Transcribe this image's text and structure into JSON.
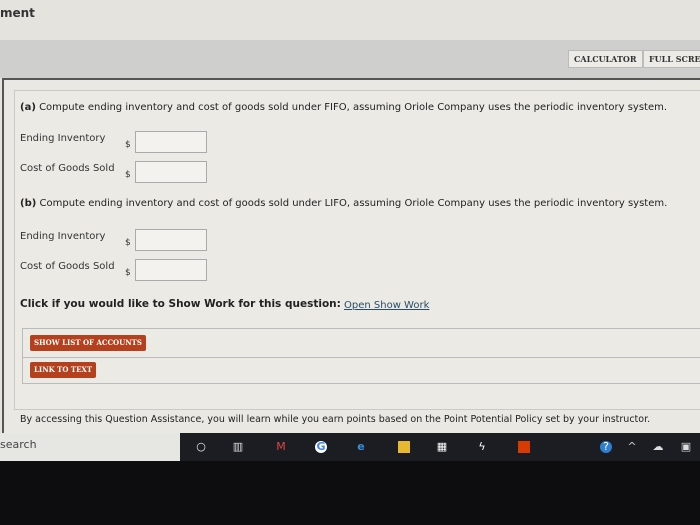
{
  "window_title": "ment",
  "toolbar": {
    "calculator": "CALCULATOR",
    "full_screen": "FULL SCREEN"
  },
  "part_a": {
    "prefix": "(a)",
    "question": "Compute ending inventory and cost of goods sold under FIFO, assuming Oriole Company uses the periodic inventory system.",
    "fields": [
      {
        "label": "Ending Inventory",
        "currency": "$",
        "value": ""
      },
      {
        "label": "Cost of Goods Sold",
        "currency": "$",
        "value": ""
      }
    ]
  },
  "part_b": {
    "prefix": "(b)",
    "question": "Compute ending inventory and cost of goods sold under LIFO, assuming Oriole Company uses the periodic inventory system.",
    "fields": [
      {
        "label": "Ending Inventory",
        "currency": "$",
        "value": ""
      },
      {
        "label": "Cost of Goods Sold",
        "currency": "$",
        "value": ""
      }
    ]
  },
  "show_work": {
    "prompt": "Click if you would like to Show Work for this question:",
    "link": "Open Show Work"
  },
  "buttons": {
    "show_accounts": "SHOW LIST OF ACCOUNTS",
    "link_to_text": "LINK TO TEXT"
  },
  "footer": "By accessing this Question Assistance, you will learn while you earn points based on the Point Potential Policy set by your instructor.",
  "taskbar": {
    "search": "search",
    "icons": [
      "cortana-icon",
      "task-view-icon",
      "gmail-icon",
      "chrome-icon",
      "edge-icon",
      "file-explorer-icon",
      "store-icon",
      "app-icon",
      "office-icon",
      "help-icon",
      "chevron-up-icon",
      "onedrive-icon",
      "notification-icon"
    ]
  },
  "colors": {
    "accent": "#b4401e",
    "link": "#2a4d66"
  }
}
